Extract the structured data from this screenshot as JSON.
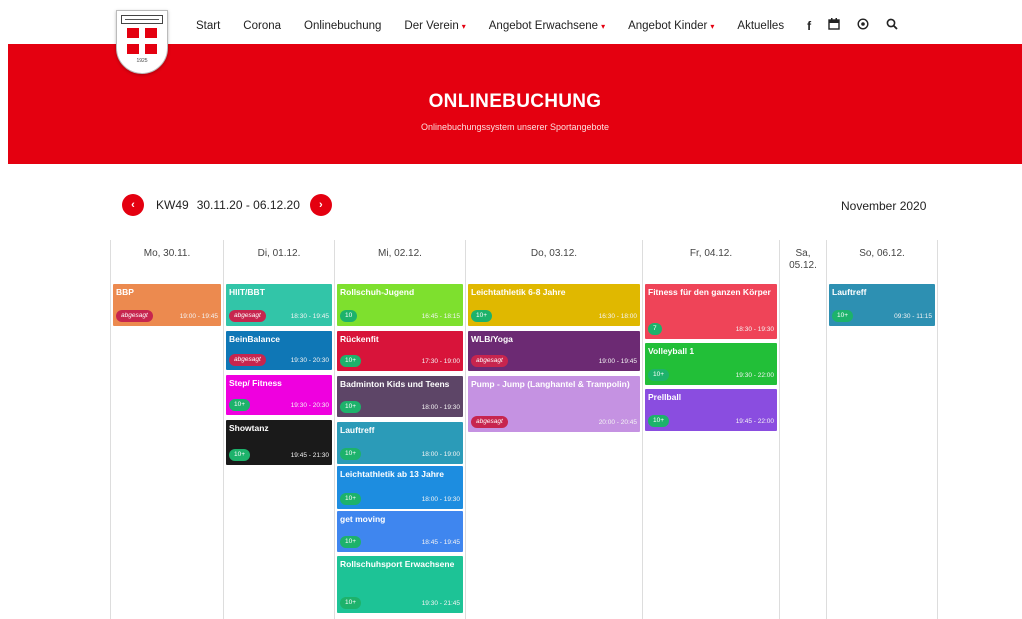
{
  "nav": {
    "items": [
      {
        "label": "Start",
        "caret": false
      },
      {
        "label": "Corona",
        "caret": false
      },
      {
        "label": "Onlinebuchung",
        "caret": false
      },
      {
        "label": "Der Verein",
        "caret": true
      },
      {
        "label": "Angebot Erwachsene",
        "caret": true
      },
      {
        "label": "Angebot Kinder",
        "caret": true
      },
      {
        "label": "Aktuelles",
        "caret": false
      }
    ],
    "logo_year": "1925",
    "icons": [
      "facebook-icon",
      "calendar-icon",
      "instagram-icon",
      "search-icon"
    ]
  },
  "hero": {
    "title": "ONLINEBUCHUNG",
    "subtitle": "Onlinebuchungssystem unserer Sportangebote"
  },
  "week": {
    "prev": "‹",
    "next": "›",
    "kw": "KW49",
    "range": "30.11.20 - 06.12.20",
    "month": "November 2020"
  },
  "colors": {
    "brand": "#e40010",
    "green_badge": "#1db26b",
    "cancel_badge": "#c7254e"
  },
  "days": [
    {
      "label": "Mo, 30.11.",
      "events": [
        {
          "title": "BBP",
          "badge": "abgesagt",
          "time": "19:00 - 19:45",
          "color": "#ec8a4f"
        }
      ]
    },
    {
      "label": "Di, 01.12.",
      "events": [
        {
          "title": "HIIT/BBT",
          "badge": "abgesagt",
          "time": "18:30 - 19:45",
          "color": "#32c5a8"
        },
        {
          "title": "BeinBalance",
          "badge": "abgesagt",
          "time": "19:30 - 20:30",
          "color": "#0f77b6"
        },
        {
          "title": "Step/ Fitness",
          "badge": "10+",
          "time": "19:30 - 20:30",
          "color": "#ef00df"
        },
        {
          "title": "Showtanz",
          "badge": "10+",
          "time": "19:45 - 21:30",
          "color": "#1a1a1a"
        }
      ]
    },
    {
      "label": "Mi, 02.12.",
      "events": [
        {
          "title": "Rollschuh-Jugend",
          "badge": "10",
          "time": "16:45 - 18:15",
          "color": "#7ee02e"
        },
        {
          "title": "Rückenfit",
          "badge": "10+",
          "time": "17:30 - 19:00",
          "color": "#d8143a"
        },
        {
          "title": "Badminton Kids und Teens",
          "badge": "10+",
          "time": "18:00 - 19:30",
          "color": "#5d4567"
        },
        {
          "title": "Lauftreff",
          "badge": "10+",
          "time": "18:00 - 19:00",
          "color": "#2b9bb8"
        },
        {
          "title": "Leichtathletik ab 13 Jahre",
          "badge": "10+",
          "time": "18:00 - 19:30",
          "color": "#1d8de0"
        },
        {
          "title": "get moving",
          "badge": "10+",
          "time": "18:45 - 19:45",
          "color": "#3f86ef"
        },
        {
          "title": "Rollschuhsport Erwachsene",
          "badge": "10+",
          "time": "19:30 - 21:45",
          "color": "#1dc396"
        }
      ]
    },
    {
      "label": "Do, 03.12.",
      "events": [
        {
          "title": "Leichtathletik 6-8 Jahre",
          "badge": "10+",
          "time": "16:30 - 18:00",
          "color": "#e0b800"
        },
        {
          "title": "WLB/Yoga",
          "badge": "abgesagt",
          "time": "19:00 - 19:45",
          "color": "#6c2a73"
        },
        {
          "title": "Pump - Jump (Langhantel & Trampolin)",
          "badge": "abgesagt",
          "time": "20:00 - 20:45",
          "color": "#c592e2"
        }
      ]
    },
    {
      "label": "Fr, 04.12.",
      "events": [
        {
          "title": "Fitness für den ganzen Körper",
          "badge": "7",
          "time": "18:30 - 19:30",
          "color": "#ef4458"
        },
        {
          "title": "Volleyball 1",
          "badge": "10+",
          "time": "19:30 - 22:00",
          "color": "#22bf38"
        },
        {
          "title": "Prellball",
          "badge": "10+",
          "time": "19:45 - 22:00",
          "color": "#8a4de0"
        }
      ]
    },
    {
      "label": "Sa, 05.12.",
      "events": []
    },
    {
      "label": "So, 06.12.",
      "events": [
        {
          "title": "Lauftreff",
          "badge": "10+",
          "time": "09:30 - 11:15",
          "color": "#2d90b2"
        }
      ]
    }
  ]
}
